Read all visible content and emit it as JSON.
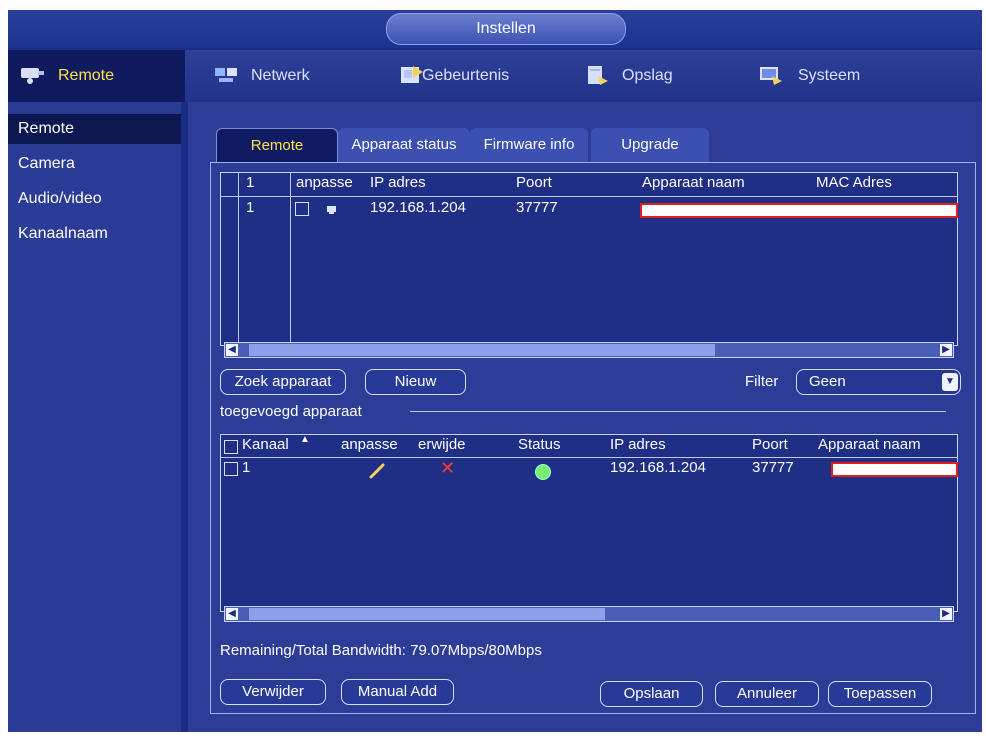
{
  "app": {
    "title": "Instellen"
  },
  "colors": {
    "accent": "#ffe14a",
    "frame": "#1a2d86",
    "highlight": "#0f1b62",
    "status_online": "#78ee74",
    "delete_icon": "#ff3b2e"
  },
  "topnav": {
    "items": [
      {
        "label": "Remote",
        "icon": "remote-camera-icon",
        "active": true
      },
      {
        "label": "Netwerk",
        "icon": "network-icon"
      },
      {
        "label": "Gebeurtenis",
        "icon": "event-icon"
      },
      {
        "label": "Opslag",
        "icon": "storage-icon"
      },
      {
        "label": "Systeem",
        "icon": "system-icon"
      }
    ]
  },
  "sidebar": {
    "items": [
      {
        "label": "Remote",
        "active": true
      },
      {
        "label": "Camera"
      },
      {
        "label": "Audio/video"
      },
      {
        "label": "Kanaalnaam"
      }
    ]
  },
  "tabs": [
    {
      "label": "Remote",
      "active": true
    },
    {
      "label": "Apparaat status"
    },
    {
      "label": "Firmware info"
    },
    {
      "label": "Upgrade"
    }
  ],
  "search_table": {
    "headers": [
      "1",
      "anpasse",
      "IP adres",
      "Poort",
      "Apparaat naam",
      "MAC Adres"
    ],
    "rows": [
      {
        "index": "1",
        "ip": "192.168.1.204",
        "port": "37777",
        "device_name": "",
        "icon": "device-icon"
      }
    ]
  },
  "buttons": {
    "search": "Zoek apparaat",
    "new": "Nieuw",
    "delete": "Verwijder",
    "manual_add": "Manual Add",
    "save": "Opslaan",
    "cancel": "Annuleer",
    "apply": "Toepassen"
  },
  "filter": {
    "label": "Filter",
    "value": "Geen"
  },
  "added_section": {
    "title": "toegevoegd apparaat"
  },
  "added_table": {
    "headers": [
      "Kanaal",
      "anpasse",
      "erwijde",
      "Status",
      "IP adres",
      "Poort",
      "Apparaat naam"
    ],
    "sort_icon": "sort-up-icon",
    "rows": [
      {
        "channel": "1",
        "edit_icon": "pencil-icon",
        "delete_icon": "delete-x-icon",
        "status": "online",
        "ip": "192.168.1.204",
        "port": "37777",
        "device_name": ""
      }
    ]
  },
  "bandwidth": {
    "text": "Remaining/Total Bandwidth: 79.07Mbps/80Mbps"
  }
}
